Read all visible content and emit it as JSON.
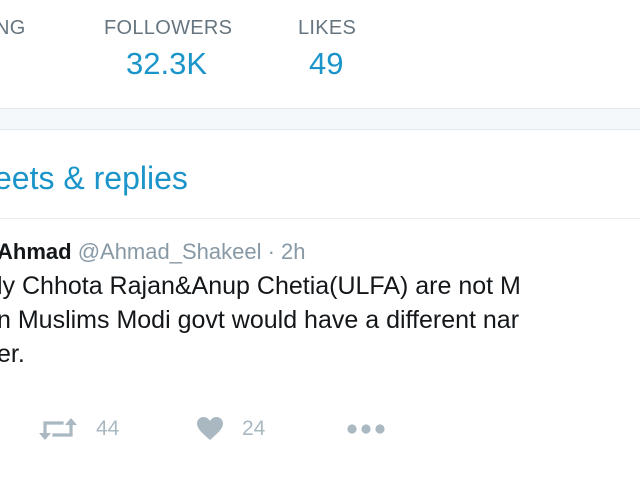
{
  "stats": {
    "following": {
      "label": "FOLLOWING",
      "shown": "WING",
      "value": ""
    },
    "followers": {
      "label": "FOLLOWERS",
      "value": "32.3K"
    },
    "likes": {
      "label": "LIKES",
      "value": "49"
    }
  },
  "timeline": {
    "title": "eets & replies"
  },
  "tweet": {
    "name": "Ahmad",
    "handle": "@Ahmad_Shakeel",
    "separator": "·",
    "time": "2h",
    "text_lines": [
      "ly Chhota Rajan&Anup Chetia(ULFA) are not M",
      "n Muslims Modi govt would have a different nar",
      "er."
    ],
    "actions": {
      "retweet_count": "44",
      "like_count": "24"
    }
  },
  "colors": {
    "accent": "#1b95c9",
    "muted": "#8899a6",
    "icon": "#aab8c2",
    "text": "#14171a"
  },
  "icons": {
    "retweet": "retweet-icon",
    "like": "heart-icon",
    "more": "more-dots-icon"
  }
}
